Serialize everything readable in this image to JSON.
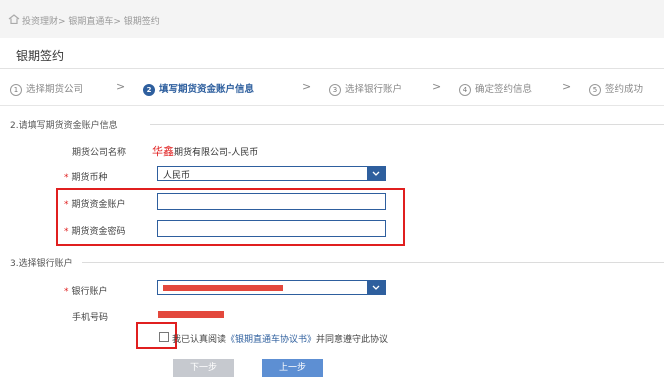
{
  "breadcrumb": {
    "text": "投资理财> 银期直通车> 银期签约"
  },
  "page": {
    "title": "银期签约"
  },
  "steps": [
    {
      "num": "1",
      "label": "选择期货公司"
    },
    {
      "num": "2",
      "label": "填写期货资金账户信息"
    },
    {
      "num": "3",
      "label": "选择银行账户"
    },
    {
      "num": "4",
      "label": "确定签约信息"
    },
    {
      "num": "5",
      "label": "签约成功"
    }
  ],
  "step_separator": ">",
  "section2": {
    "title": "2.请填写期货资金账户信息"
  },
  "form": {
    "company_label": "期货公司名称",
    "company_brand": "华鑫",
    "company_value": "期货有限公司-人民币",
    "currency_label": "期货币种",
    "currency_value": "人民币",
    "account_label": "期货资金账户",
    "password_label": "期货资金密码",
    "required_mark": "*"
  },
  "section3": {
    "title": "3.选择银行账户"
  },
  "bank": {
    "bank_account_label": "银行账户",
    "phone_label": "手机号码",
    "agree_prefix": "我已认真阅读",
    "agree_link": "《银期直通车协议书》",
    "agree_suffix": "并同意遵守此协议"
  },
  "buttons": {
    "next": "下一步",
    "prev": "上一步"
  },
  "colors": {
    "accent": "#2e5f9e",
    "highlight": "#e01f1f",
    "redact": "#e3483c"
  }
}
